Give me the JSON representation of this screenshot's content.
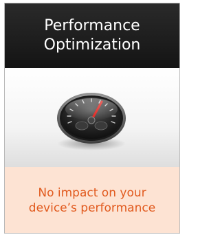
{
  "card": {
    "title": "Performance\nOptimization",
    "icon": "speedometer-icon",
    "caption": "No impact on your\ndevice’s performance"
  },
  "colors": {
    "header_bg": "#1c1c1c",
    "footer_bg": "#fde3d3",
    "caption_text": "#e15a1e",
    "needle": "#e0201a"
  }
}
